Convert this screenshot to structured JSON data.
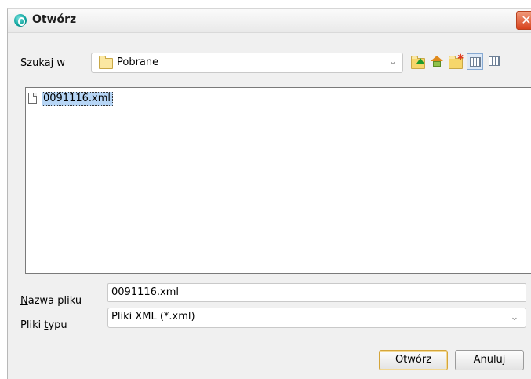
{
  "dialog": {
    "title": "Otwórz",
    "close_symbol": "✕"
  },
  "lookin": {
    "label": "Szukaj w",
    "current_folder": "Pobrane",
    "folder_icon": "folder-icon"
  },
  "toolbar": {
    "buttons": [
      {
        "name": "up-one-level",
        "icon": "folder-up-icon"
      },
      {
        "name": "home",
        "icon": "home-icon"
      },
      {
        "name": "new-folder",
        "icon": "new-folder-icon"
      },
      {
        "name": "list-view",
        "icon": "list-view-icon",
        "active": true
      },
      {
        "name": "details-view",
        "icon": "details-view-icon"
      }
    ]
  },
  "file_list": {
    "items": [
      {
        "name": "0091116.xml",
        "selected": true,
        "icon": "file-icon"
      }
    ]
  },
  "file_name": {
    "label_mnemonic": "N",
    "label_rest": "azwa pliku",
    "value": "0091116.xml"
  },
  "file_type": {
    "label_prefix": "Pliki ",
    "label_mnemonic": "t",
    "label_rest": "ypu",
    "selected": "Pliki XML (*.xml)"
  },
  "buttons": {
    "open": "Otwórz",
    "cancel": "Anuluj"
  },
  "colors": {
    "selection": "#b6d5f5",
    "close_button": "#d8431e",
    "dialog_bg": "#f0f0f0"
  }
}
